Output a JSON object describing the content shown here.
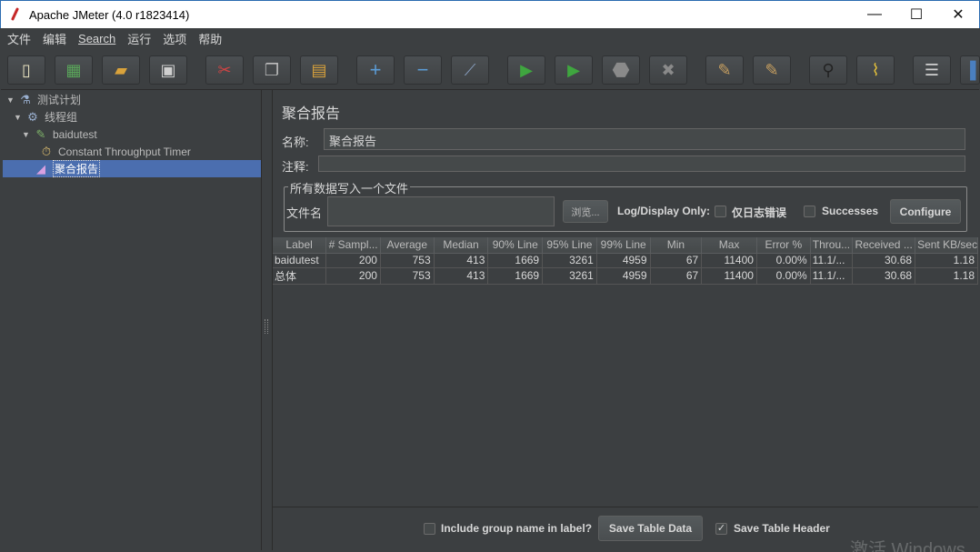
{
  "window": {
    "title": "Apache JMeter (4.0 r1823414)",
    "minimize": "—",
    "maximize": "☐",
    "close": "✕"
  },
  "menu": [
    "文件",
    "编辑",
    "Search",
    "运行",
    "选项",
    "帮助"
  ],
  "toolbar": [
    {
      "icon": "new-icon",
      "glyph": "▯"
    },
    {
      "icon": "templates-icon",
      "glyph": "▦"
    },
    {
      "icon": "open-icon",
      "glyph": "▰"
    },
    {
      "icon": "save-icon",
      "glyph": "▣"
    },
    {
      "icon": "cut-icon",
      "glyph": "✂"
    },
    {
      "icon": "copy-icon",
      "glyph": "❐"
    },
    {
      "icon": "paste-icon",
      "glyph": "▤"
    },
    {
      "icon": "expand-icon",
      "glyph": "+"
    },
    {
      "icon": "collapse-icon",
      "glyph": "−"
    },
    {
      "icon": "toggle-icon",
      "glyph": "⟋"
    },
    {
      "icon": "start-icon",
      "glyph": "▶"
    },
    {
      "icon": "start-no-pause-icon",
      "glyph": "▶"
    },
    {
      "icon": "stop-icon",
      "glyph": "⬣"
    },
    {
      "icon": "shutdown-icon",
      "glyph": "✖"
    },
    {
      "icon": "clear-icon",
      "glyph": "✎"
    },
    {
      "icon": "clear-all-icon",
      "glyph": "✎"
    },
    {
      "icon": "search-icon",
      "glyph": "⚲"
    },
    {
      "icon": "reset-search-icon",
      "glyph": "⌇"
    },
    {
      "icon": "function-helper-icon",
      "glyph": "☰"
    },
    {
      "icon": "help-icon",
      "glyph": "▐"
    }
  ],
  "tree": {
    "test_plan": "测试计划",
    "thread_group": "线程组",
    "sampler": "baidutest",
    "timer": "Constant Throughput Timer",
    "listener": "聚合报告"
  },
  "panel": {
    "title": "聚合报告",
    "name_label": "名称:",
    "name_value": "聚合报告",
    "comment_label": "注释:",
    "comment_value": "",
    "file_group_title": "所有数据写入一个文件",
    "filename_label": "文件名",
    "filename_value": "",
    "browse_button": "浏览...",
    "log_display_only": "Log/Display Only:",
    "errors_only_label": "仅日志错误",
    "successes_label": "Successes",
    "configure_button": "Configure"
  },
  "table": {
    "columns": [
      "Label",
      "# Sampl...",
      "Average",
      "Median",
      "90% Line",
      "95% Line",
      "99% Line",
      "Min",
      "Max",
      "Error %",
      "Throu...",
      "Received ...",
      "Sent KB/sec"
    ],
    "rows": [
      [
        "baidutest",
        "200",
        "753",
        "413",
        "1669",
        "3261",
        "4959",
        "67",
        "11400",
        "0.00%",
        "11.1/...",
        "30.68",
        "1.18"
      ],
      [
        "总体",
        "200",
        "753",
        "413",
        "1669",
        "3261",
        "4959",
        "67",
        "11400",
        "0.00%",
        "11.1/...",
        "30.68",
        "1.18"
      ]
    ]
  },
  "bottom": {
    "include_group_label": "Include group name in label?",
    "save_table_data": "Save Table Data",
    "save_table_header": "Save Table Header",
    "include_group_checked": false,
    "save_header_checked": true
  },
  "watermark": "激活 Windows",
  "colors": {
    "background": "#3c3f41",
    "selection": "#4b6eaf",
    "title_bar": "#ffffff"
  }
}
